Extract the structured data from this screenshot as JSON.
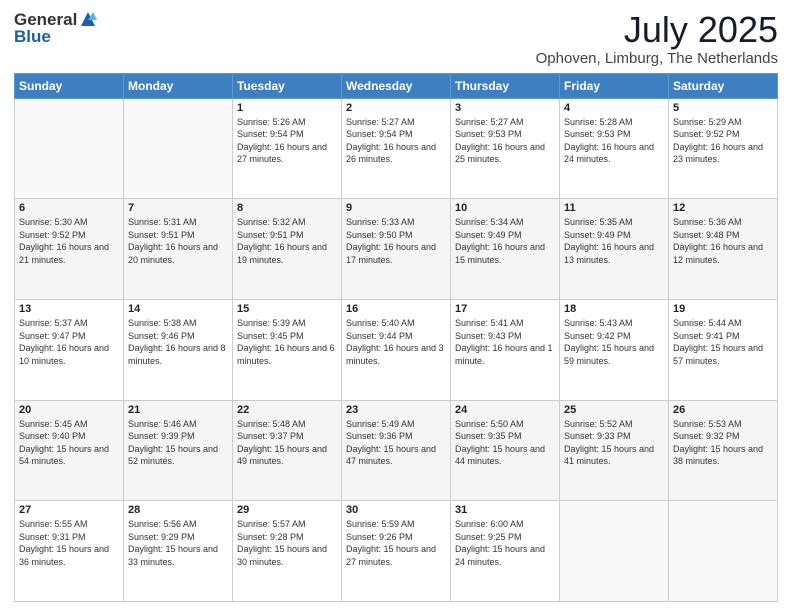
{
  "header": {
    "logo_general": "General",
    "logo_blue": "Blue",
    "month_title": "July 2025",
    "location": "Ophoven, Limburg, The Netherlands"
  },
  "weekdays": [
    "Sunday",
    "Monday",
    "Tuesday",
    "Wednesday",
    "Thursday",
    "Friday",
    "Saturday"
  ],
  "weeks": [
    [
      {
        "day": "",
        "sunrise": "",
        "sunset": "",
        "daylight": ""
      },
      {
        "day": "",
        "sunrise": "",
        "sunset": "",
        "daylight": ""
      },
      {
        "day": "1",
        "sunrise": "Sunrise: 5:26 AM",
        "sunset": "Sunset: 9:54 PM",
        "daylight": "Daylight: 16 hours and 27 minutes."
      },
      {
        "day": "2",
        "sunrise": "Sunrise: 5:27 AM",
        "sunset": "Sunset: 9:54 PM",
        "daylight": "Daylight: 16 hours and 26 minutes."
      },
      {
        "day": "3",
        "sunrise": "Sunrise: 5:27 AM",
        "sunset": "Sunset: 9:53 PM",
        "daylight": "Daylight: 16 hours and 25 minutes."
      },
      {
        "day": "4",
        "sunrise": "Sunrise: 5:28 AM",
        "sunset": "Sunset: 9:53 PM",
        "daylight": "Daylight: 16 hours and 24 minutes."
      },
      {
        "day": "5",
        "sunrise": "Sunrise: 5:29 AM",
        "sunset": "Sunset: 9:52 PM",
        "daylight": "Daylight: 16 hours and 23 minutes."
      }
    ],
    [
      {
        "day": "6",
        "sunrise": "Sunrise: 5:30 AM",
        "sunset": "Sunset: 9:52 PM",
        "daylight": "Daylight: 16 hours and 21 minutes."
      },
      {
        "day": "7",
        "sunrise": "Sunrise: 5:31 AM",
        "sunset": "Sunset: 9:51 PM",
        "daylight": "Daylight: 16 hours and 20 minutes."
      },
      {
        "day": "8",
        "sunrise": "Sunrise: 5:32 AM",
        "sunset": "Sunset: 9:51 PM",
        "daylight": "Daylight: 16 hours and 19 minutes."
      },
      {
        "day": "9",
        "sunrise": "Sunrise: 5:33 AM",
        "sunset": "Sunset: 9:50 PM",
        "daylight": "Daylight: 16 hours and 17 minutes."
      },
      {
        "day": "10",
        "sunrise": "Sunrise: 5:34 AM",
        "sunset": "Sunset: 9:49 PM",
        "daylight": "Daylight: 16 hours and 15 minutes."
      },
      {
        "day": "11",
        "sunrise": "Sunrise: 5:35 AM",
        "sunset": "Sunset: 9:49 PM",
        "daylight": "Daylight: 16 hours and 13 minutes."
      },
      {
        "day": "12",
        "sunrise": "Sunrise: 5:36 AM",
        "sunset": "Sunset: 9:48 PM",
        "daylight": "Daylight: 16 hours and 12 minutes."
      }
    ],
    [
      {
        "day": "13",
        "sunrise": "Sunrise: 5:37 AM",
        "sunset": "Sunset: 9:47 PM",
        "daylight": "Daylight: 16 hours and 10 minutes."
      },
      {
        "day": "14",
        "sunrise": "Sunrise: 5:38 AM",
        "sunset": "Sunset: 9:46 PM",
        "daylight": "Daylight: 16 hours and 8 minutes."
      },
      {
        "day": "15",
        "sunrise": "Sunrise: 5:39 AM",
        "sunset": "Sunset: 9:45 PM",
        "daylight": "Daylight: 16 hours and 6 minutes."
      },
      {
        "day": "16",
        "sunrise": "Sunrise: 5:40 AM",
        "sunset": "Sunset: 9:44 PM",
        "daylight": "Daylight: 16 hours and 3 minutes."
      },
      {
        "day": "17",
        "sunrise": "Sunrise: 5:41 AM",
        "sunset": "Sunset: 9:43 PM",
        "daylight": "Daylight: 16 hours and 1 minute."
      },
      {
        "day": "18",
        "sunrise": "Sunrise: 5:43 AM",
        "sunset": "Sunset: 9:42 PM",
        "daylight": "Daylight: 15 hours and 59 minutes."
      },
      {
        "day": "19",
        "sunrise": "Sunrise: 5:44 AM",
        "sunset": "Sunset: 9:41 PM",
        "daylight": "Daylight: 15 hours and 57 minutes."
      }
    ],
    [
      {
        "day": "20",
        "sunrise": "Sunrise: 5:45 AM",
        "sunset": "Sunset: 9:40 PM",
        "daylight": "Daylight: 15 hours and 54 minutes."
      },
      {
        "day": "21",
        "sunrise": "Sunrise: 5:46 AM",
        "sunset": "Sunset: 9:39 PM",
        "daylight": "Daylight: 15 hours and 52 minutes."
      },
      {
        "day": "22",
        "sunrise": "Sunrise: 5:48 AM",
        "sunset": "Sunset: 9:37 PM",
        "daylight": "Daylight: 15 hours and 49 minutes."
      },
      {
        "day": "23",
        "sunrise": "Sunrise: 5:49 AM",
        "sunset": "Sunset: 9:36 PM",
        "daylight": "Daylight: 15 hours and 47 minutes."
      },
      {
        "day": "24",
        "sunrise": "Sunrise: 5:50 AM",
        "sunset": "Sunset: 9:35 PM",
        "daylight": "Daylight: 15 hours and 44 minutes."
      },
      {
        "day": "25",
        "sunrise": "Sunrise: 5:52 AM",
        "sunset": "Sunset: 9:33 PM",
        "daylight": "Daylight: 15 hours and 41 minutes."
      },
      {
        "day": "26",
        "sunrise": "Sunrise: 5:53 AM",
        "sunset": "Sunset: 9:32 PM",
        "daylight": "Daylight: 15 hours and 38 minutes."
      }
    ],
    [
      {
        "day": "27",
        "sunrise": "Sunrise: 5:55 AM",
        "sunset": "Sunset: 9:31 PM",
        "daylight": "Daylight: 15 hours and 36 minutes."
      },
      {
        "day": "28",
        "sunrise": "Sunrise: 5:56 AM",
        "sunset": "Sunset: 9:29 PM",
        "daylight": "Daylight: 15 hours and 33 minutes."
      },
      {
        "day": "29",
        "sunrise": "Sunrise: 5:57 AM",
        "sunset": "Sunset: 9:28 PM",
        "daylight": "Daylight: 15 hours and 30 minutes."
      },
      {
        "day": "30",
        "sunrise": "Sunrise: 5:59 AM",
        "sunset": "Sunset: 9:26 PM",
        "daylight": "Daylight: 15 hours and 27 minutes."
      },
      {
        "day": "31",
        "sunrise": "Sunrise: 6:00 AM",
        "sunset": "Sunset: 9:25 PM",
        "daylight": "Daylight: 15 hours and 24 minutes."
      },
      {
        "day": "",
        "sunrise": "",
        "sunset": "",
        "daylight": ""
      },
      {
        "day": "",
        "sunrise": "",
        "sunset": "",
        "daylight": ""
      }
    ]
  ]
}
